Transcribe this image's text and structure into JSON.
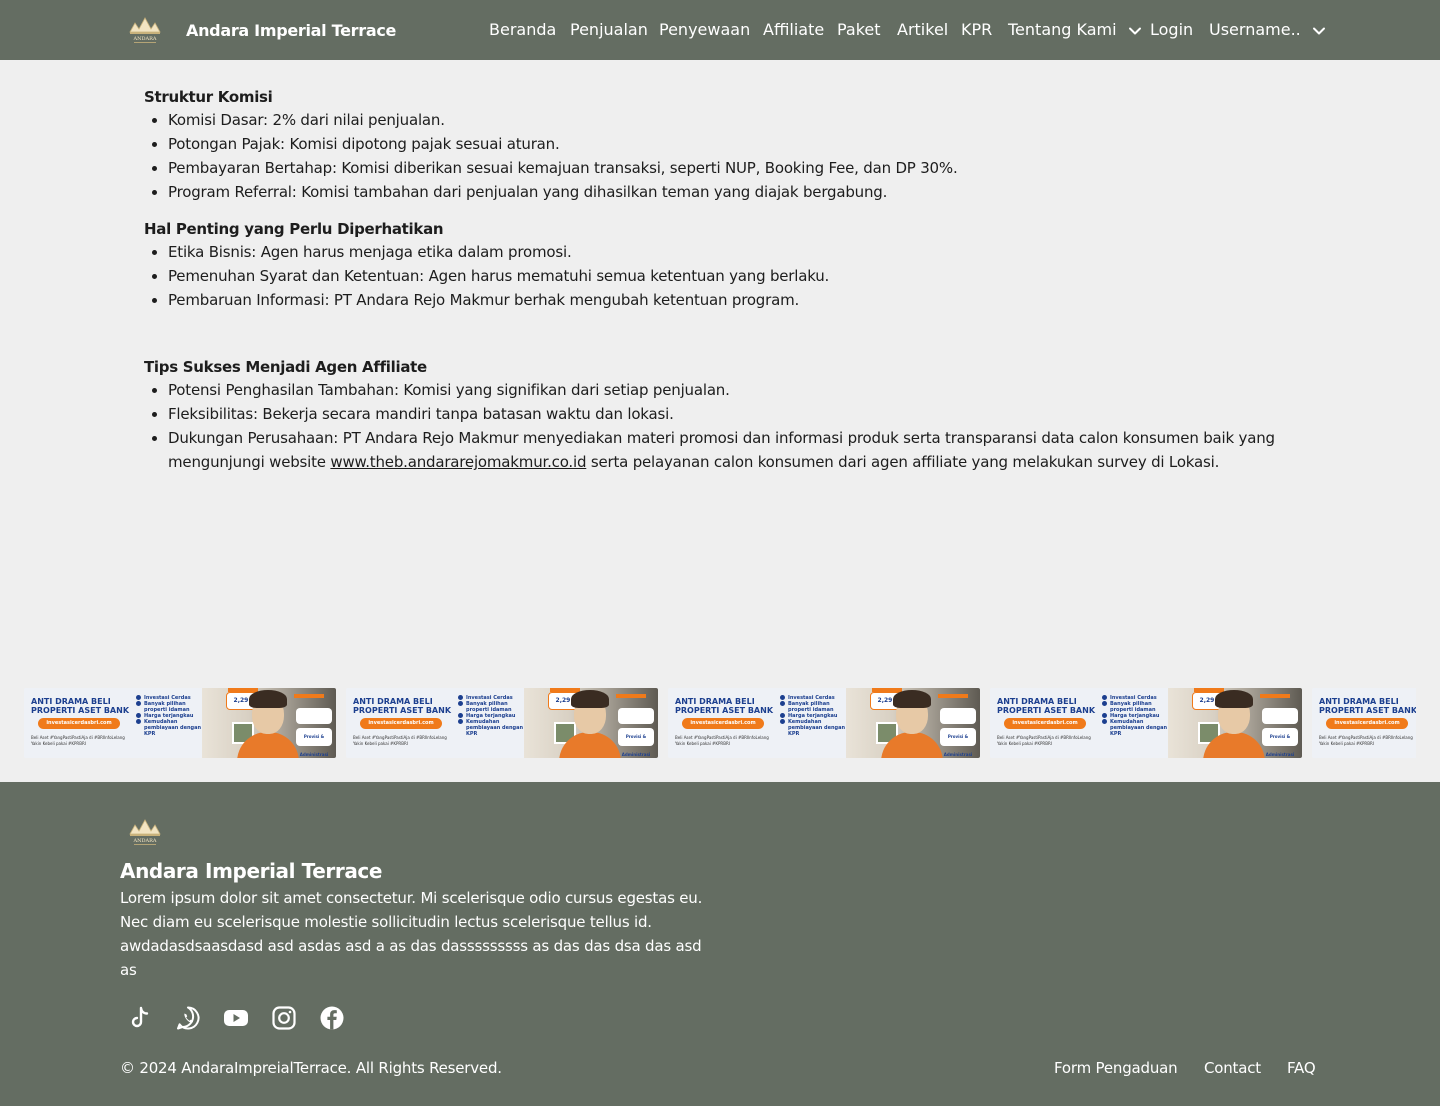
{
  "navbar": {
    "brand_name": "Andara Imperial Terrace",
    "logo_text": "ANDARA",
    "items": [
      {
        "label": "Beranda"
      },
      {
        "label": "Penjualan"
      },
      {
        "label": "Penyewaan"
      },
      {
        "label": "Affiliate"
      },
      {
        "label": "Paket"
      },
      {
        "label": "Artikel"
      },
      {
        "label": "KPR"
      },
      {
        "label": "Tentang Kami"
      },
      {
        "label": "Login"
      },
      {
        "label": "Username.."
      }
    ]
  },
  "content": {
    "section1": {
      "heading": "Struktur Komisi",
      "items": [
        "Komisi Dasar: 2% dari nilai penjualan.",
        "Potongan Pajak: Komisi dipotong pajak sesuai aturan.",
        "Pembayaran Bertahap: Komisi diberikan sesuai kemajuan transaksi, seperti NUP, Booking Fee, dan DP 30%.",
        "Program Referral: Komisi tambahan dari penjualan yang dihasilkan teman yang diajak bergabung."
      ]
    },
    "section2": {
      "heading": "Hal Penting yang Perlu Diperhatikan",
      "items": [
        "Etika Bisnis: Agen harus menjaga etika dalam promosi.",
        "Pemenuhan Syarat dan Ketentuan: Agen harus mematuhi semua ketentuan yang berlaku.",
        "Pembaruan Informasi: PT Andara Rejo Makmur berhak mengubah ketentuan program."
      ]
    },
    "section3": {
      "heading": "Tips Sukses Menjadi Agen Affiliate",
      "items": [
        "Potensi Penghasilan Tambahan: Komisi yang signifikan dari setiap penjualan.",
        "Fleksibilitas: Bekerja secara mandiri tanpa batasan waktu dan lokasi."
      ],
      "item3_before": "Dukungan Perusahaan: PT Andara Rejo Makmur menyediakan materi promosi dan informasi produk serta transparansi data calon konsumen baik yang mengunjungi website ",
      "item3_link": "www.theb.andararejomakmur.co.id",
      "item3_after": " serta pelayanan calon konsumen dari agen affiliate yang melakukan survey di Lokasi."
    }
  },
  "banner": {
    "title": "ANTI DRAMA BELI PROPERTI ASET BANK",
    "pill": "investasicerdasbri.com",
    "small": "Beli Aset #YangPastiPastiAja di #BRIlnfoLelang Yakin Kebeli pakai #KPRBRI",
    "list": [
      "Investasi Cerdas",
      "Banyak pilihan properti idaman",
      "Harga terjangkau",
      "Kemudahan pembiayaan dengan KPR"
    ],
    "rate": "2,29 %",
    "box_text": "Provisi & Administrasi"
  },
  "footer": {
    "title": "Andara Imperial Terrace",
    "description": "Lorem ipsum dolor sit amet consectetur. Mi scelerisque odio cursus egestas eu. Nec diam eu scelerisque molestie sollicitudin lectus scelerisque tellus id. awdadasdsaasdasd asd asdas asd a as das dasssssssss as das das dsa das asd as",
    "social_icons": [
      "tiktok-icon",
      "whatsapp-icon",
      "youtube-icon",
      "instagram-icon",
      "facebook-icon"
    ],
    "copyright": "© 2024 AndaraImpreialTerrace. All Rights Reserved.",
    "links": [
      {
        "label": "Form Pengaduan"
      },
      {
        "label": "Contact"
      },
      {
        "label": "FAQ"
      }
    ]
  },
  "colors": {
    "navbar_bg": "#646d62",
    "page_bg": "#efefef",
    "banner_accent": "#f07a1a",
    "banner_blue": "#1c3f8f"
  }
}
